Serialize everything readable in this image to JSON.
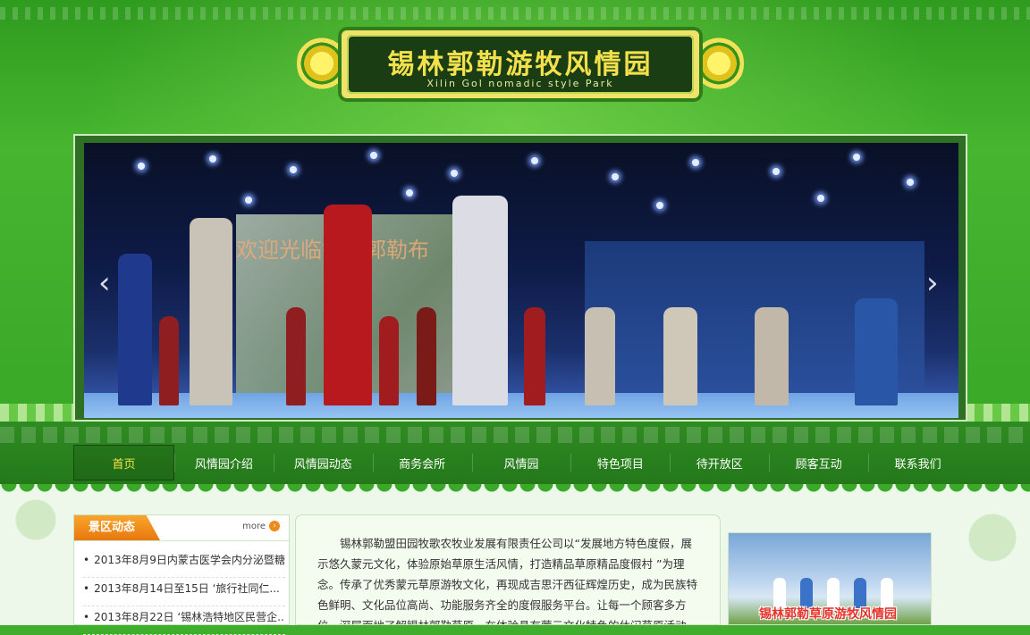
{
  "site": {
    "title": "锡林郭勒游牧风情园",
    "subtitle": "Xilin Gol nomadic style Park"
  },
  "banner": {
    "screen_text": "欢迎光临锡林郭勒布",
    "prev_icon": "chevron-left-icon",
    "next_icon": "chevron-right-icon"
  },
  "nav": {
    "items": [
      "首页",
      "风情园介绍",
      "风情园动态",
      "商务会所",
      "风情园",
      "特色项目",
      "待开放区",
      "顾客互动",
      "联系我们"
    ],
    "active_index": 0
  },
  "news": {
    "title": "景区动态",
    "more_label": "more",
    "items": [
      "2013年8月9日内蒙古医学会内分泌暨糖...",
      "2013年8月14日至15日 ‘旅行社同仁...",
      "2013年8月22日 ‘锡林浩特地区民营企..."
    ]
  },
  "intro": {
    "text": "锡林郭勒盟田园牧歌农牧业发展有限责任公司以“发展地方特色度假，展示悠久蒙元文化，体验原始草原生活风情，打造精品草原精品度假村 ”为理念。传承了优秀蒙元草原游牧文化，再现成吉思汗西征辉煌历史，成为民族特色鲜明、文化品位高尚、功能服务齐全的度假服务平台。让每一个顾客多方位、深层面地了解锡林郭勒草原，在体验具有蒙元文化特色的休闲草原活动中，融入其中，亲身感受草原游牧文化"
  },
  "photo": {
    "caption": "锡林郭勒草原游牧风情园"
  },
  "colors": {
    "header_green": "#3fae2c",
    "nav_green": "#2f8c22",
    "active_nav_text": "#f6e24a",
    "news_tab_orange": "#f08a17",
    "caption_red": "#e5322a"
  }
}
